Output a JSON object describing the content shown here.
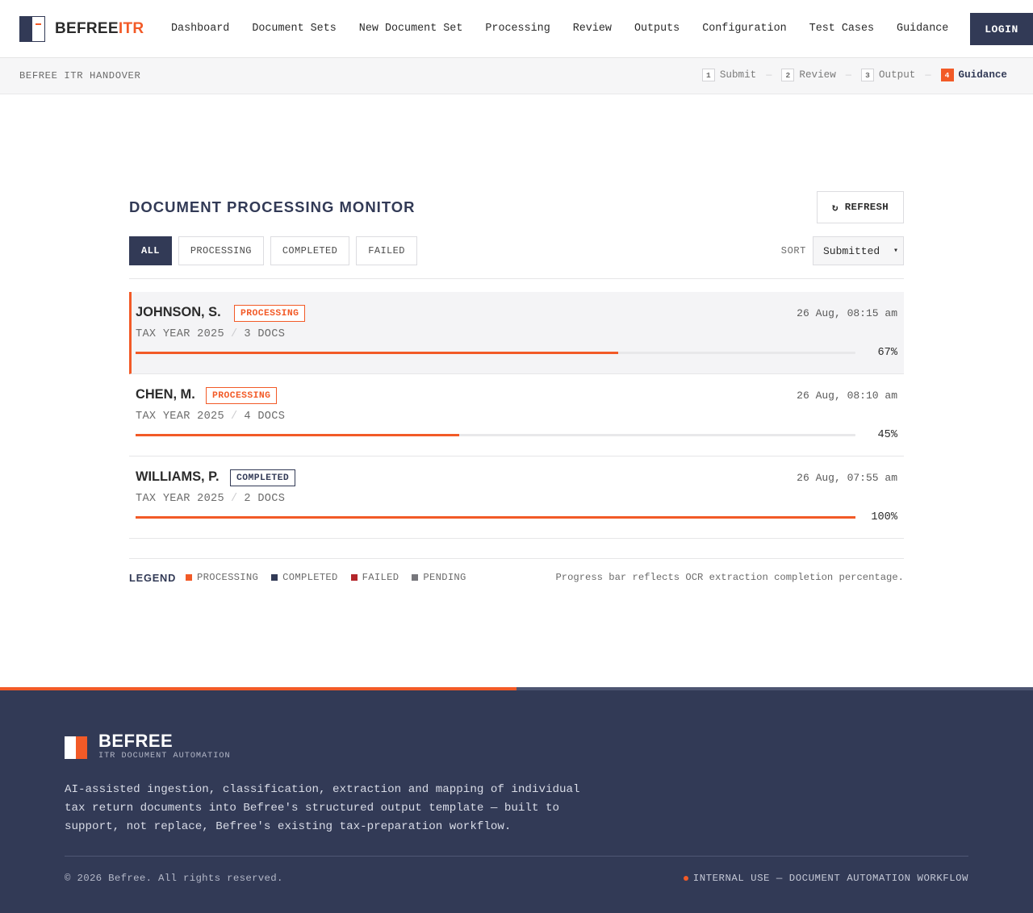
{
  "brand": {
    "name_a": "BEFREE",
    "name_b": "ITR"
  },
  "nav": {
    "links": [
      "Dashboard",
      "Document Sets",
      "New Document Set",
      "Processing",
      "Review",
      "Outputs",
      "Configuration",
      "Test Cases",
      "Guidance"
    ],
    "login_label": "LOGIN"
  },
  "subbar": {
    "handover": "BEFREE ITR HANDOVER",
    "steps": [
      {
        "num": "1",
        "label": "Submit"
      },
      {
        "num": "2",
        "label": "Review"
      },
      {
        "num": "3",
        "label": "Output"
      },
      {
        "num": "4",
        "label": "Guidance"
      }
    ],
    "separator": "—"
  },
  "monitor": {
    "title": "DOCUMENT PROCESSING MONITOR",
    "refresh_icon": "↻",
    "refresh_label": "REFRESH",
    "filters": [
      "ALL",
      "PROCESSING",
      "COMPLETED",
      "FAILED"
    ],
    "sort_label": "SORT",
    "sort_value": "Submitted",
    "rows": [
      {
        "name": "JOHNSON, S.",
        "status": "PROCESSING",
        "date": "26 Aug, 08:15 am",
        "tax_year": "TAX YEAR 2025",
        "docs": "3 DOCS",
        "progress": 67,
        "progress_label": "67%"
      },
      {
        "name": "CHEN, M.",
        "status": "PROCESSING",
        "date": "26 Aug, 08:10 am",
        "tax_year": "TAX YEAR 2025",
        "docs": "4 DOCS",
        "progress": 45,
        "progress_label": "45%"
      },
      {
        "name": "WILLIAMS, P.",
        "status": "COMPLETED",
        "date": "26 Aug, 07:55 am",
        "tax_year": "TAX YEAR 2025",
        "docs": "2 DOCS",
        "progress": 100,
        "progress_label": "100%"
      }
    ],
    "meta_separator": "/"
  },
  "legend": {
    "title": "LEGEND",
    "items": [
      {
        "label": "PROCESSING",
        "color": "#f25a27"
      },
      {
        "label": "COMPLETED",
        "color": "#323a56"
      },
      {
        "label": "FAILED",
        "color": "#b3262b"
      },
      {
        "label": "PENDING",
        "color": "#77777c"
      }
    ],
    "note": "Progress bar reflects OCR extraction completion percentage."
  },
  "footer": {
    "brand": "BEFREE",
    "sub": "ITR DOCUMENT AUTOMATION",
    "description": "AI-assisted ingestion, classification, extraction and mapping of individual tax return documents into Befree's structured output template — built to support, not replace, Befree's existing tax-preparation workflow.",
    "copyright": "© 2026 Befree. All rights reserved.",
    "internal": "INTERNAL USE — DOCUMENT AUTOMATION WORKFLOW"
  },
  "colors": {
    "accent": "#f25a27",
    "navy": "#323a56"
  }
}
